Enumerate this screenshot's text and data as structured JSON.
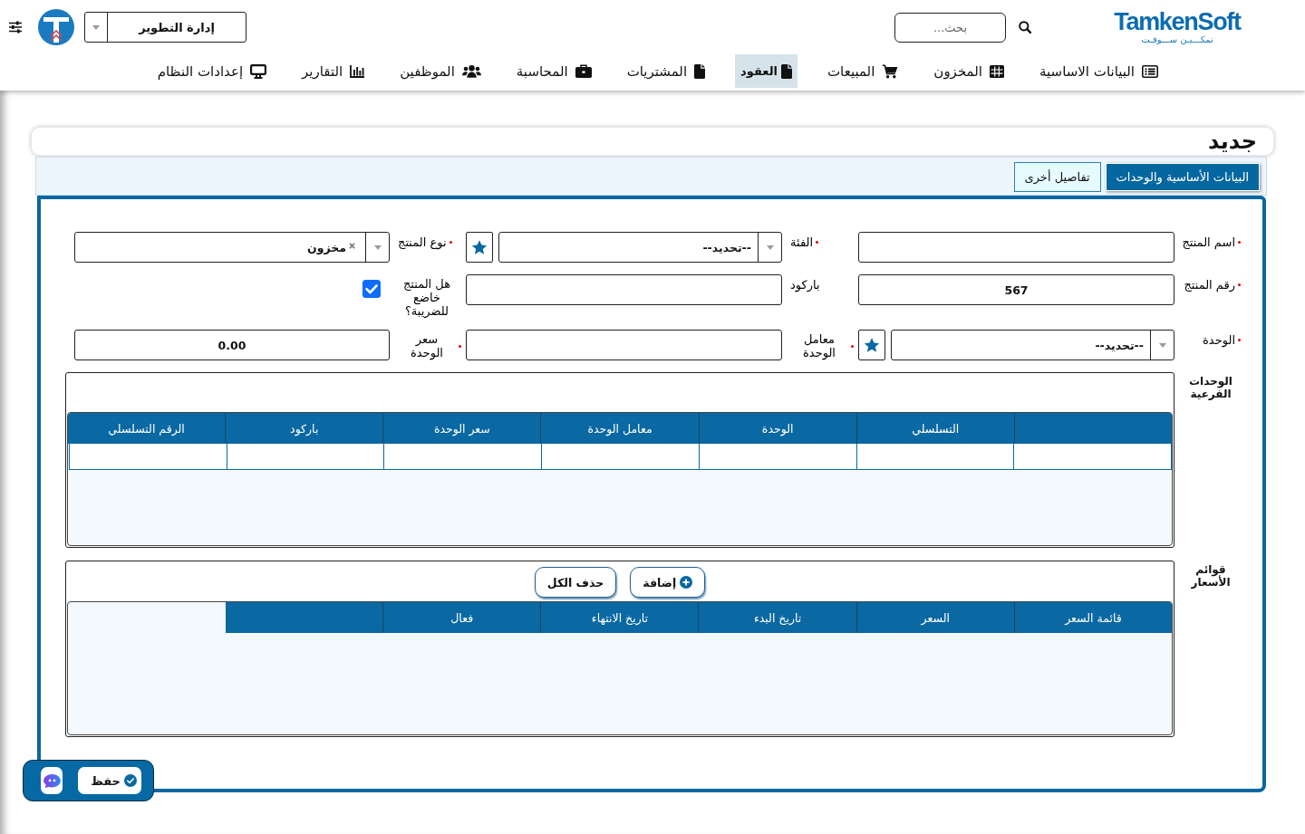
{
  "header": {
    "logo": {
      "wordmark": "TamkenSoft",
      "tagline": "تمكـــيـن ســـوفـت"
    },
    "search": {
      "placeholder": "بحث..."
    },
    "org_select": {
      "value": "إدارة التطوير"
    }
  },
  "nav": [
    {
      "label": "البيانات الاساسية",
      "selected": false
    },
    {
      "label": "المخزون",
      "selected": false
    },
    {
      "label": "المبيعات",
      "selected": false
    },
    {
      "label": "العقود",
      "selected": true
    },
    {
      "label": "المشتريات",
      "selected": false
    },
    {
      "label": "المحاسبة",
      "selected": false
    },
    {
      "label": "الموظفين",
      "selected": false
    },
    {
      "label": "التقارير",
      "selected": false
    },
    {
      "label": "إعدادات النظام",
      "selected": false
    }
  ],
  "page": {
    "title": "جديد"
  },
  "tabs": [
    {
      "label": "البيانات الأساسية والوحدات",
      "selected": true
    },
    {
      "label": "تفاصيل أخرى",
      "selected": false
    }
  ],
  "form": {
    "fields": [
      {
        "kind": "text",
        "label": "اسم المنتج",
        "required": true
      },
      {
        "kind": "select-add",
        "label": "الفئة",
        "required": true,
        "placeholder": "--تحديد--"
      },
      {
        "kind": "tags",
        "label": "نوع المنتج",
        "required": true,
        "tags": [
          "مخزون"
        ]
      },
      {
        "kind": "text",
        "label": "رقم المنتج",
        "required": true,
        "value": "567"
      },
      {
        "kind": "text",
        "label": "باركود",
        "required": false
      },
      {
        "kind": "checkbox",
        "label": "هل المنتج خاضع للضريبة؟",
        "required": false,
        "checked": true
      },
      {
        "kind": "select-add",
        "label": "الوحدة",
        "required": true,
        "placeholder": "--تحديد--"
      },
      {
        "kind": "text",
        "label": "معامل الوحدة",
        "required": true
      },
      {
        "kind": "text",
        "label": "سعر الوحدة",
        "required": true,
        "value": "0.00"
      }
    ]
  },
  "sub_units": {
    "label": "الوحدات الفرعية",
    "table": {
      "columns": [
        {
          "kind": "blank"
        },
        {
          "kind": "text",
          "label": "التسلسلي"
        },
        {
          "kind": "text",
          "label": "الوحدة"
        },
        {
          "kind": "text",
          "label": "معامل الوحدة"
        },
        {
          "kind": "text",
          "label": "سعر الوحدة"
        },
        {
          "kind": "text",
          "label": "باركود"
        },
        {
          "kind": "text",
          "label": "الرقم التسلسلي"
        }
      ],
      "rows": [
        {
          "kind": "blank"
        }
      ]
    }
  },
  "price_lists": {
    "label": "قوائم الأسعار",
    "buttons": [
      {
        "kind": "add",
        "label": "إضافة"
      },
      {
        "kind": "plain",
        "label": "حذف الكل"
      }
    ],
    "table": {
      "columns": [
        {
          "kind": "text",
          "label": "قائمة السعر"
        },
        {
          "kind": "text",
          "label": "السعر"
        },
        {
          "kind": "text",
          "label": "تاريخ البدء"
        },
        {
          "kind": "text",
          "label": "تاريخ الانتهاء"
        },
        {
          "kind": "text",
          "label": "فعال"
        },
        {
          "kind": "blank"
        }
      ]
    }
  },
  "toolbar": {
    "buttons": [
      {
        "kind": "save",
        "label": "حفظ"
      },
      {
        "kind": "icon"
      }
    ]
  }
}
